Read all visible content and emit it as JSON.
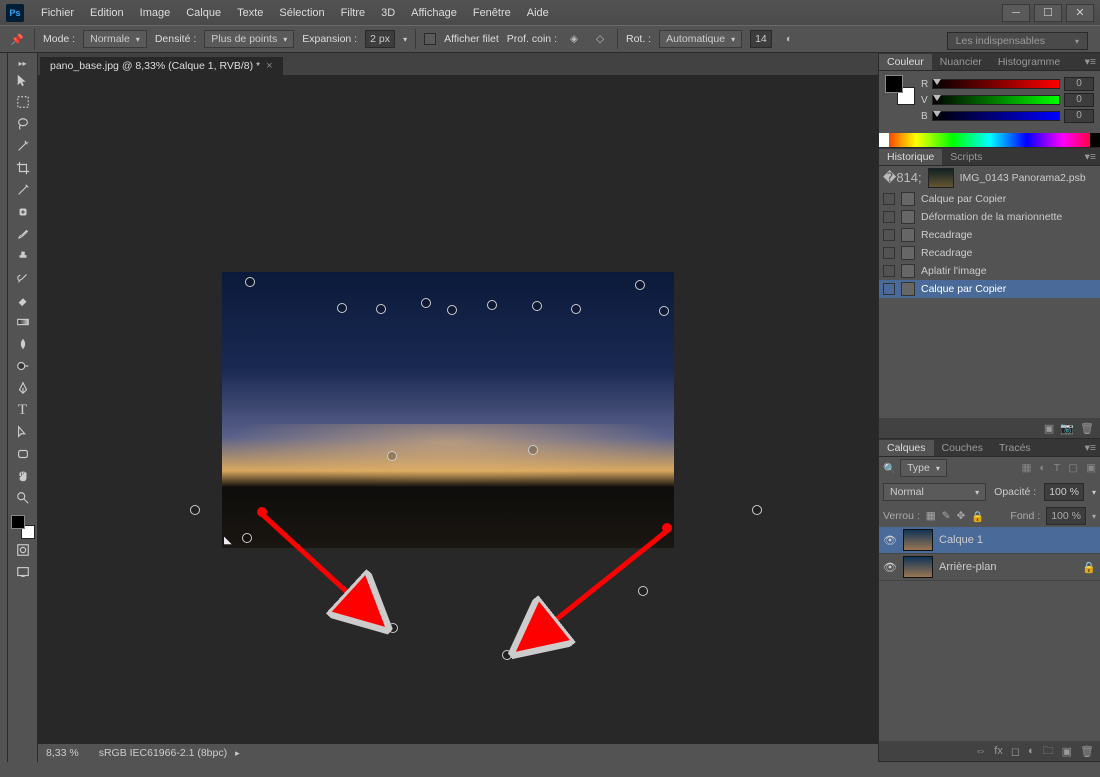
{
  "app": {
    "logo": "Ps"
  },
  "menubar": [
    "Fichier",
    "Edition",
    "Image",
    "Calque",
    "Texte",
    "Sélection",
    "Filtre",
    "3D",
    "Affichage",
    "Fenêtre",
    "Aide"
  ],
  "optionsbar": {
    "mode_label": "Mode :",
    "mode_value": "Normale",
    "density_label": "Densité :",
    "density_value": "Plus de points",
    "expansion_label": "Expansion :",
    "expansion_value": "2 px",
    "show_mesh": "Afficher filet",
    "depth_label": "Prof. coin :",
    "rot_label": "Rot. :",
    "rot_value": "Automatique",
    "rot_deg": "14",
    "presets": "Les indispensables"
  },
  "document": {
    "tab": "pano_base.jpg @ 8,33% (Calque 1, RVB/8) *"
  },
  "status": {
    "zoom": "8,33 %",
    "profile": "sRGB IEC61966-2.1 (8bpc)"
  },
  "panels": {
    "color": {
      "tabs": [
        "Couleur",
        "Nuancier",
        "Histogramme"
      ],
      "channels": {
        "r": "R",
        "v": "V",
        "b": "B",
        "val": "0"
      }
    },
    "history": {
      "tabs": [
        "Historique",
        "Scripts"
      ],
      "snapshot": "IMG_0143 Panorama2.psb",
      "items": [
        "Calque par Copier",
        "Déformation de la marionnette",
        "Recadrage",
        "Recadrage",
        "Aplatir l'image",
        "Calque par Copier"
      ]
    },
    "layers": {
      "tabs": [
        "Calques",
        "Couches",
        "Tracés"
      ],
      "filter_label": "Type",
      "blend": "Normal",
      "opacity_label": "Opacité :",
      "opacity_value": "100 %",
      "lock_label": "Verrou :",
      "fill_label": "Fond :",
      "fill_value": "100 %",
      "rows": [
        {
          "name": "Calque 1"
        },
        {
          "name": "Arrière-plan"
        }
      ]
    }
  }
}
